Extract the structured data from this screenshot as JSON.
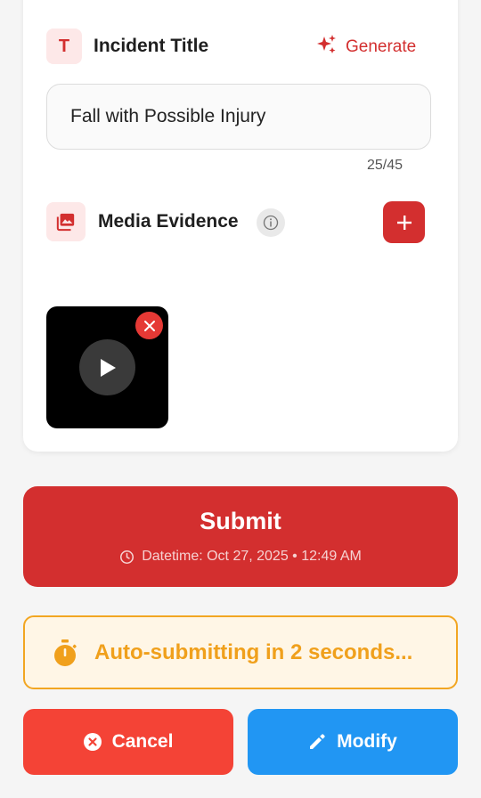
{
  "title_section": {
    "icon_letter": "T",
    "label": "Incident Title",
    "generate_label": "Generate",
    "input_value": "Fall with Possible Injury",
    "counter": "25/45"
  },
  "media_section": {
    "label": "Media Evidence",
    "add_label": "+"
  },
  "submit": {
    "label": "Submit",
    "datetime": "Datetime: Oct 27, 2025 • 12:49 AM"
  },
  "autosubmit": {
    "text": "Auto-submitting in 2 seconds..."
  },
  "actions": {
    "cancel_label": "Cancel",
    "modify_label": "Modify"
  },
  "colors": {
    "primary_red": "#d32f2f",
    "cancel_red": "#f44336",
    "modify_blue": "#2196f3",
    "warning_orange": "#f0a01c"
  }
}
